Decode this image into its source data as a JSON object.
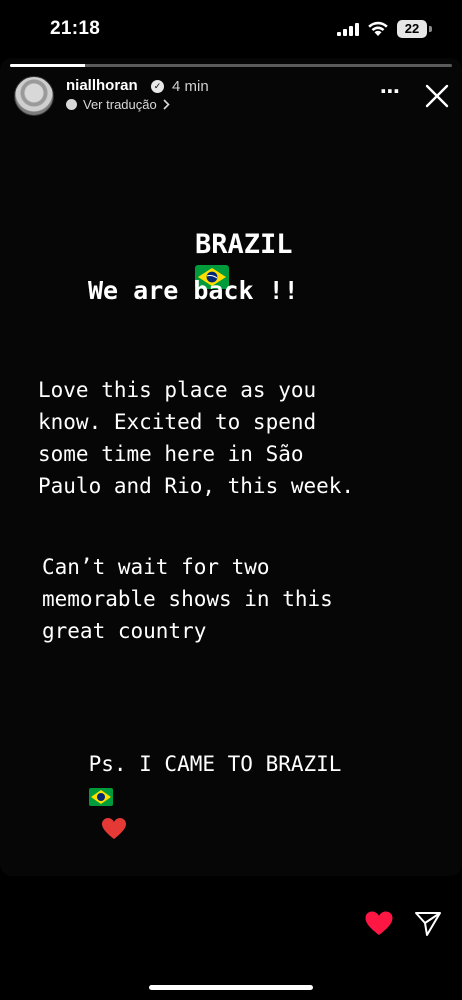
{
  "status_bar": {
    "time": "21:18",
    "battery": "22"
  },
  "story": {
    "progress": 0.17,
    "username": "niallhoran",
    "verified_mark": "✓",
    "posted_ago": "4 min",
    "translate_label": "Ver tradução",
    "more_label": "⋯",
    "title": "BRAZIL",
    "line_back": "We are back !!",
    "paragraph_1": "Love this place as you\nknow. Excited to spend\nsome time here in São\nPaulo and Rio, this week.",
    "paragraph_2": "Can’t wait for two\nmemorable shows in this\ngreat country",
    "ps_text": "Ps. I CAME TO BRAZIL"
  },
  "icons": {
    "flag": "brazil-flag-icon",
    "heart": "heart-icon",
    "send": "send-icon",
    "close": "close-icon"
  },
  "colors": {
    "heart": "#ff1744",
    "flag_green": "#009b3a",
    "flag_yellow": "#ffdf00",
    "flag_blue": "#002776"
  }
}
